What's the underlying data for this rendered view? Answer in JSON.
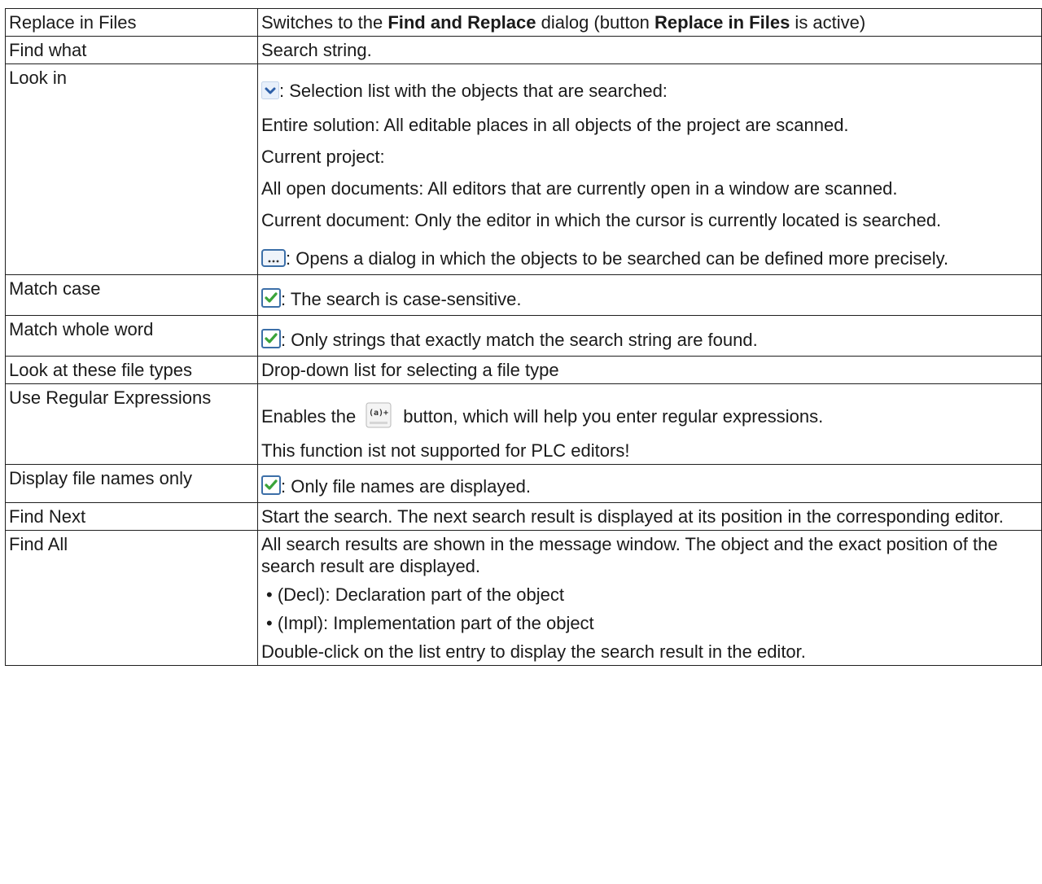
{
  "rows": [
    {
      "label": "Replace in Files",
      "text_a": "Switches to the ",
      "bold_a": "Find and Replace",
      "text_b": " dialog (button ",
      "bold_b": "Replace in Files",
      "text_c": " is active)"
    },
    {
      "label": "Find what",
      "desc": "Search string."
    },
    {
      "label": "Look in",
      "dropdown_desc": ": Selection list with the objects that are searched:",
      "options": [
        "Entire solution: All editable places in all objects of the project are scanned.",
        "Current project:",
        "All open documents: All editors that are currently open in a window are scanned.",
        "Current document: Only the editor in which the cursor is currently located is searched."
      ],
      "browse_desc": ": Opens a dialog in which the objects to be searched can be defined more precisely."
    },
    {
      "label": "Match case",
      "desc": ": The search is case-sensitive."
    },
    {
      "label": "Match whole word",
      "desc": ": Only strings that exactly match the search string are found."
    },
    {
      "label": "Look at these file types",
      "desc": "Drop-down list for selecting a file type"
    },
    {
      "label": "Use Regular Expressions",
      "desc_before": "Enables the",
      "desc_after": "button, which will help you enter regular expressions.",
      "note": "This function ist not supported for PLC editors!"
    },
    {
      "label": "Display file names only",
      "desc": ": Only file names are displayed."
    },
    {
      "label": "Find Next",
      "desc": "Start the search. The next search result is displayed at its position in the corresponding editor."
    },
    {
      "label": "Find All",
      "desc": "All search results are shown in the message window. The object and the exact position of the search result are displayed.",
      "bullets": [
        "(Decl): Declaration part of the object",
        "(Impl): Implementation part of the object"
      ],
      "footer": "Double-click on the list entry to display the search result in the editor."
    }
  ],
  "icons": {
    "dropdown": "chevron-down-icon",
    "browse": "ellipsis-button-icon",
    "checkbox": "checked-checkbox-icon",
    "regex": "regex-insert-icon"
  },
  "colors": {
    "checkmark": "#3aa43a",
    "icon_border": "#3c6fa8",
    "chevron": "#2d5fa8"
  }
}
